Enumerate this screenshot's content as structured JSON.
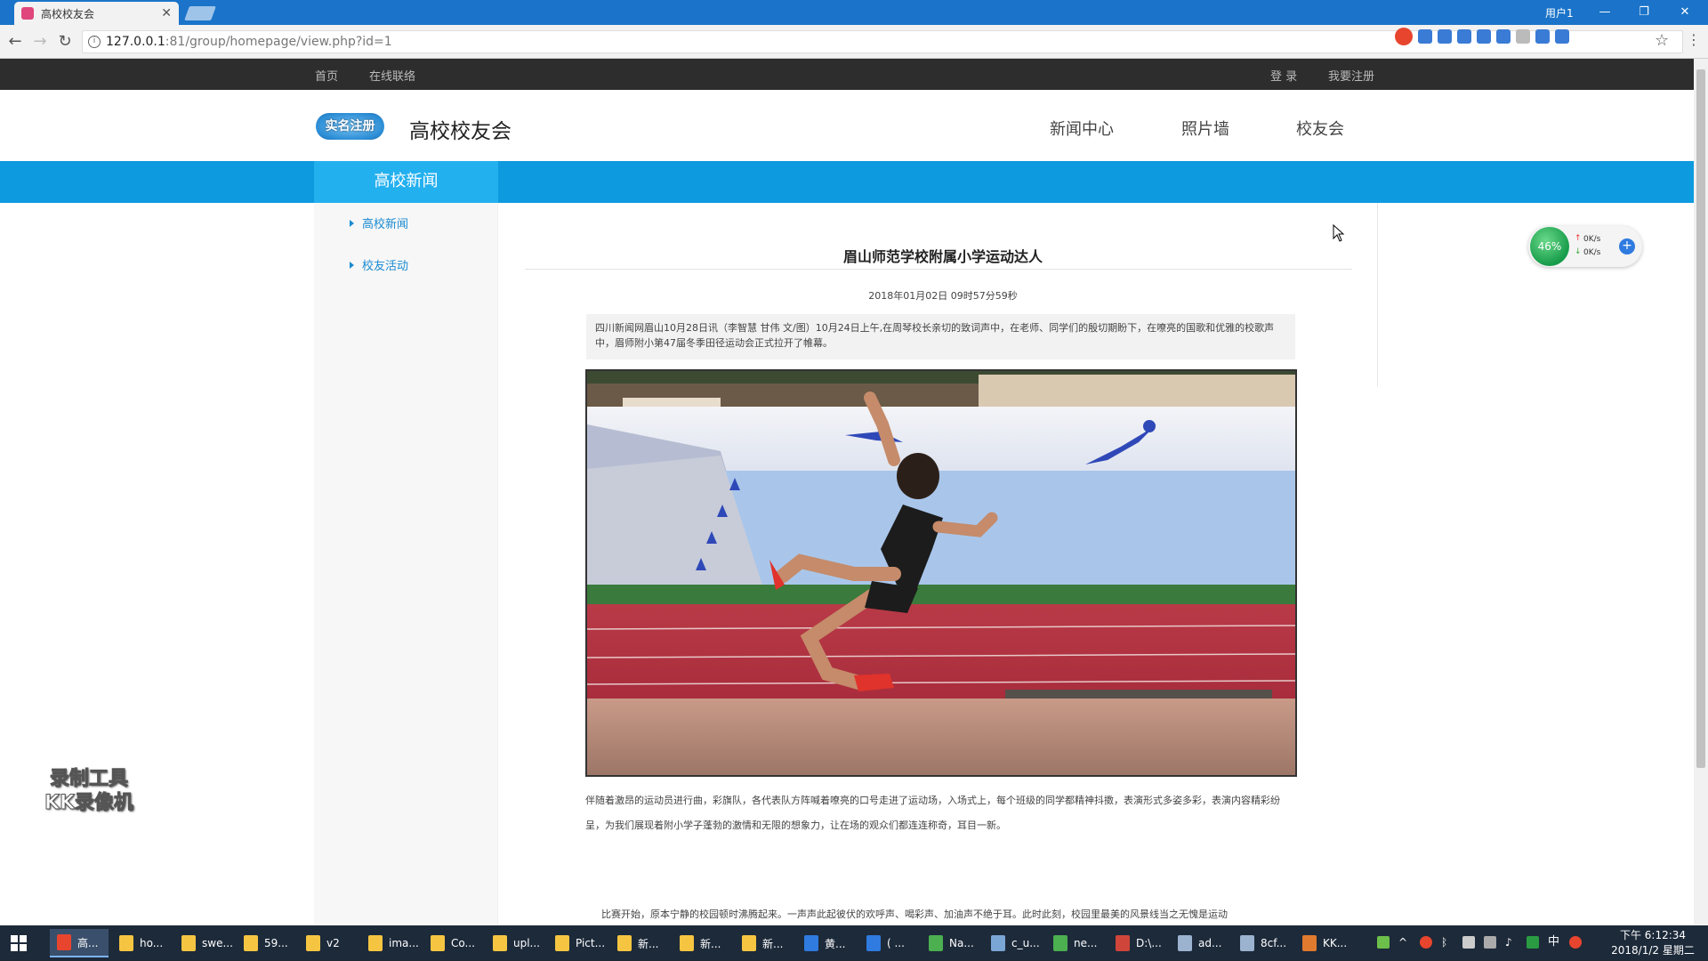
{
  "browser": {
    "tab_title": "高校校友会",
    "user_label": "用户1",
    "url_host": "127.0.0.1",
    "url_path": ":81/group/homepage/view.php?id=1"
  },
  "topbar": {
    "home": "首页",
    "contact": "在线联络",
    "login": "登 录",
    "register": "我要注册"
  },
  "header": {
    "badge": "实名注册",
    "site_title": "高校校友会",
    "nav": [
      "新闻中心",
      "照片墙",
      "校友会"
    ]
  },
  "banner": {
    "section_title": "高校新闻"
  },
  "sidebar": {
    "items": [
      "高校新闻",
      "校友活动"
    ]
  },
  "article": {
    "title": "眉山师范学校附属小学运动达人",
    "date": "2018年01月02日 09时57分59秒",
    "summary": "四川新闻网眉山10月28日讯（李智慧 甘伟 文/图）10月24日上午,在周琴校长亲切的致词声中，在老师、同学们的殷切期盼下，在嘹亮的国歌和优雅的校歌声中，眉师附小第47届冬季田径运动会正式拉开了帷幕。",
    "para1": "伴随着激昂的运动员进行曲，彩旗队，各代表队方阵喊着嘹亮的口号走进了运动场，入场式上，每个班级的同学都精神抖擞，表演形式多姿多彩，表演内容精彩纷呈，为我们展现着附小学子蓬勃的激情和无限的想象力，让在场的观众们都连连称奇，耳目一新。",
    "para2": "比赛开始，原本宁静的校园顿时沸腾起来。一声声此起彼伏的欢呼声、喝彩声、加油声不绝于耳。此时此刻，校园里最美的风景线当之无愧是运动"
  },
  "speed_widget": {
    "percent": "46%",
    "up": "0K/s",
    "down": "0K/s"
  },
  "watermark": {
    "line1": "录制工具",
    "line2": "KK录像机"
  },
  "taskbar": {
    "items": [
      "高...",
      "ho...",
      "swe...",
      "59...",
      "v2",
      "ima...",
      "Co...",
      "upl...",
      "Pict...",
      "新...",
      "新...",
      "新...",
      "黄...",
      "( ...",
      "Na...",
      "c_u...",
      "ne...",
      "D:\\...",
      "ad...",
      "8cf...",
      "KK..."
    ],
    "ime": "中",
    "time": "下午 6:12:34",
    "date": "2018/1/2 星期二"
  },
  "colors": {
    "brand_blue": "#0e9ade",
    "tab_blue": "#23b0ef",
    "topbar_dark": "#2d2d2d"
  }
}
